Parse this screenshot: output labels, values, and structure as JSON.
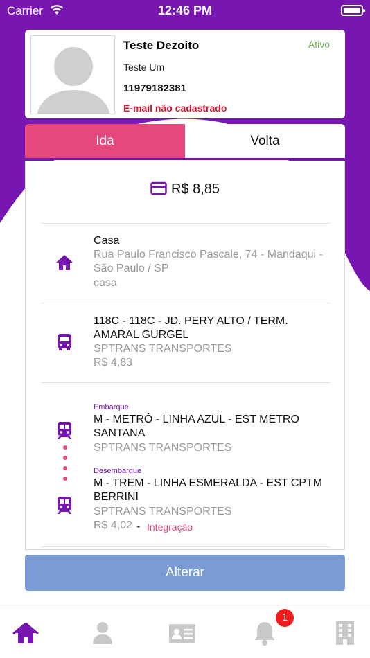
{
  "status_bar": {
    "carrier": "Carrier",
    "time": "12:46 PM"
  },
  "colors": {
    "purple": "#7816b2",
    "pink": "#e5497c",
    "button": "#7b9bd4",
    "active_green": "#6ab04c",
    "error_red": "#e0102d"
  },
  "profile": {
    "name": "Teste Dezoito",
    "status": "Ativo",
    "subtitle": "Teste Um",
    "phone": "11979182381",
    "email_notice": "E-mail não cadastrado"
  },
  "tabs": {
    "ida": "Ida",
    "volta": "Volta"
  },
  "fare": {
    "icon": "credit-card-icon",
    "total": "R$ 8,85"
  },
  "home": {
    "icon": "home-icon",
    "title": "Casa",
    "address_line1": "Rua Paulo Francisco Pascale, 74 - Mandaqui -",
    "address_line2": "São Paulo / SP",
    "note": "casa"
  },
  "bus": {
    "icon": "bus-icon",
    "line1": "118C - 118C - JD. PERY ALTO / TERM.",
    "line2": "AMARAL GURGEL",
    "operator": "SPTRANS TRANSPORTES",
    "price": "R$ 4,83"
  },
  "metro": {
    "icon": "train-icon",
    "boarding_label": "Embarque",
    "boarding_line1": "M - METRÔ - LINHA AZUL - EST METRO",
    "boarding_line2": "SANTANA",
    "boarding_operator": "SPTRANS TRANSPORTES",
    "alighting_label": "Desembarque",
    "alighting_line1": "M - TREM - LINHA ESMERALDA - EST CPTM",
    "alighting_line2": "BERRINI",
    "alighting_operator": "SPTRANS TRANSPORTES",
    "price": "R$ 4,02",
    "dash": "-",
    "integration": "Integração"
  },
  "button": {
    "label": "Alterar"
  },
  "tabbar": {
    "items": [
      "home-icon",
      "person-icon",
      "id-card-icon",
      "bell-icon",
      "building-icon"
    ],
    "notification_count": "1"
  }
}
